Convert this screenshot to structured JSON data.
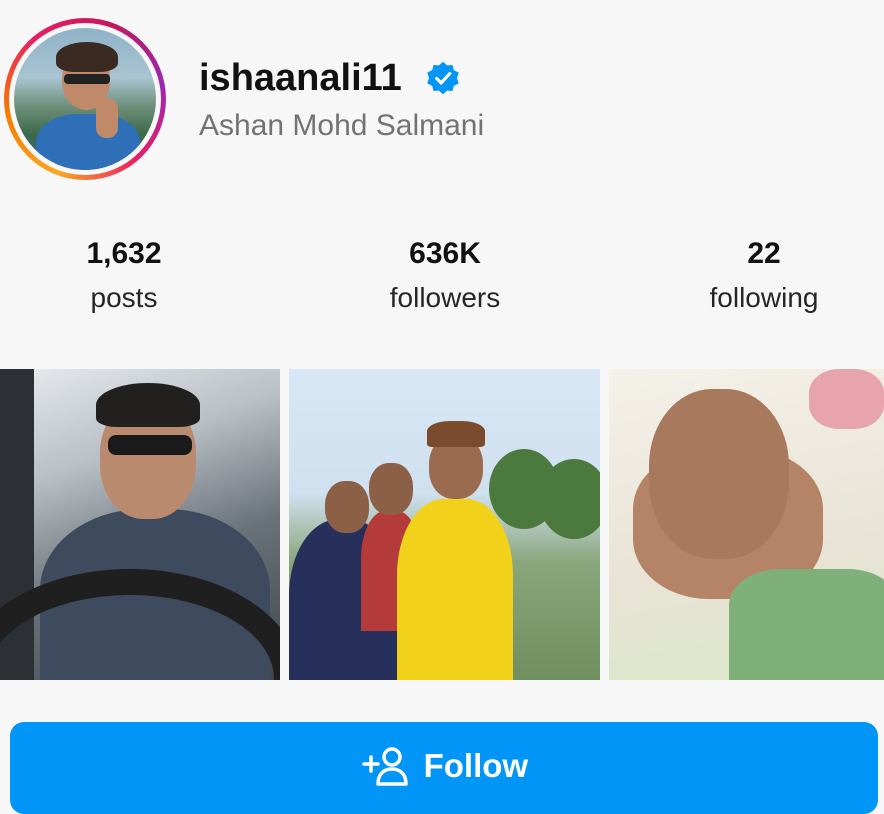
{
  "profile": {
    "username": "ishaanali11",
    "full_name": "Ashan Mohd Salmani",
    "verified": true
  },
  "stats": [
    {
      "value": "1,632",
      "label": "posts"
    },
    {
      "value": "636K",
      "label": "followers"
    },
    {
      "value": "22",
      "label": "following"
    }
  ],
  "posts": [
    {
      "icon": "photo-thumbnail"
    },
    {
      "icon": "photo-thumbnail"
    },
    {
      "icon": "photo-thumbnail"
    }
  ],
  "follow_button": {
    "label": "Follow",
    "icon": "add-person-icon"
  },
  "colors": {
    "accent": "#0095f6",
    "verified": "#0095f6",
    "secondary_text": "#737373",
    "background": "#f7f7f7"
  }
}
